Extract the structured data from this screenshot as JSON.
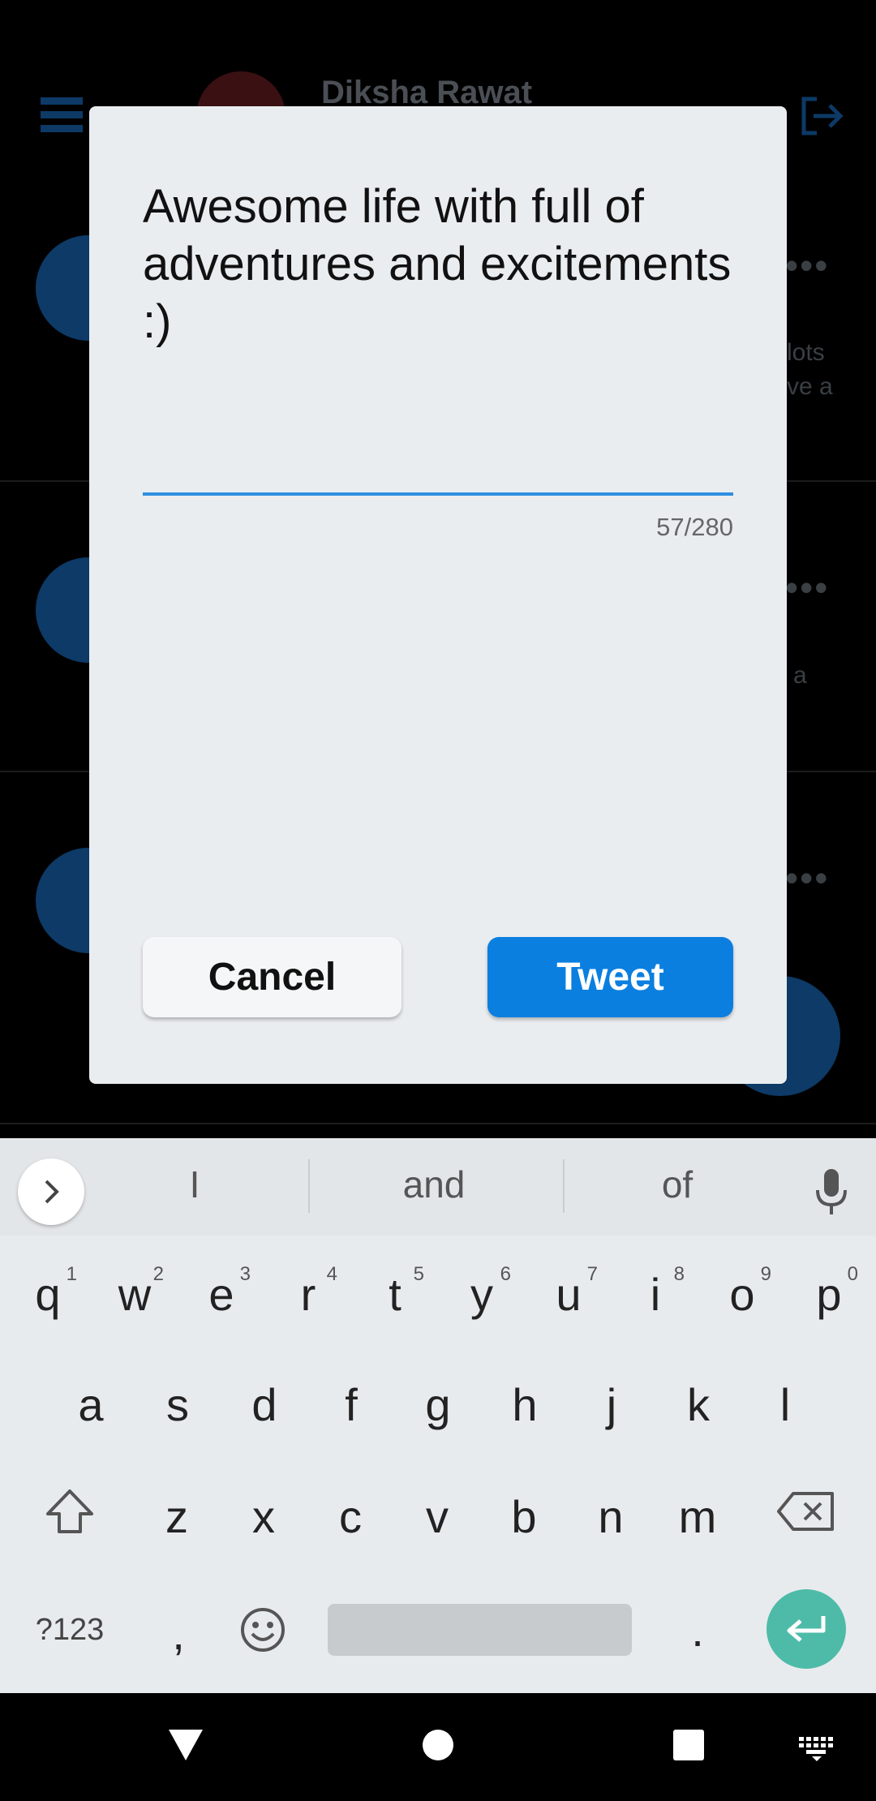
{
  "background": {
    "user_name": "Diksha Rawat",
    "feed_snippets": [
      {
        "line1": "lots",
        "line2": "ve a"
      },
      {
        "line1": "a",
        "line2": ""
      }
    ],
    "dots": "•••"
  },
  "dialog": {
    "tweet_text": "Awesome life with full of adventures and excitements   :)",
    "char_count": "57/280",
    "cancel_label": "Cancel",
    "tweet_label": "Tweet"
  },
  "keyboard": {
    "suggestions": [
      "I",
      "and",
      "of"
    ],
    "row1": [
      {
        "k": "q",
        "n": "1"
      },
      {
        "k": "w",
        "n": "2"
      },
      {
        "k": "e",
        "n": "3"
      },
      {
        "k": "r",
        "n": "4"
      },
      {
        "k": "t",
        "n": "5"
      },
      {
        "k": "y",
        "n": "6"
      },
      {
        "k": "u",
        "n": "7"
      },
      {
        "k": "i",
        "n": "8"
      },
      {
        "k": "o",
        "n": "9"
      },
      {
        "k": "p",
        "n": "0"
      }
    ],
    "row2": [
      "a",
      "s",
      "d",
      "f",
      "g",
      "h",
      "j",
      "k",
      "l"
    ],
    "row3": [
      "z",
      "x",
      "c",
      "v",
      "b",
      "n",
      "m"
    ],
    "symbols_label": "?123",
    "comma": ",",
    "period": "."
  },
  "colors": {
    "accent": "#0b7fe0",
    "input_underline": "#2d8fe0",
    "enter_key": "#4dbba8",
    "dialog_bg": "#eaedf0"
  }
}
